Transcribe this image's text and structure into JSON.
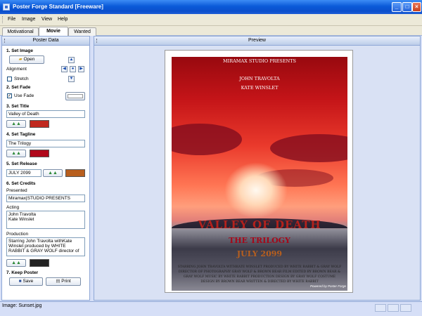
{
  "window": {
    "title": "Poster Forge Standard [Freeware]"
  },
  "menu": [
    "File",
    "Image",
    "View",
    "Help"
  ],
  "tabs": [
    "Motivational",
    "Movie",
    "Wanted"
  ],
  "left_pane": {
    "title": "Poster Data",
    "set_image": {
      "heading": "1. Set Image",
      "open_label": "Open",
      "alignment_label": "Alignment",
      "stretch_label": "Stretch",
      "stretch_checked": false
    },
    "set_fade": {
      "heading": "2. Set Fade",
      "use_fade_label": "Use Fade",
      "use_fade_checked": true,
      "fade_color": "#ffffff"
    },
    "set_title": {
      "heading": "3. Set Title",
      "value": "Valley of Death",
      "color": "#c0281e"
    },
    "set_tagline": {
      "heading": "4. Set Tagline",
      "value": "The Trilogy",
      "color": "#b0081a"
    },
    "set_release": {
      "heading": "5. Set Release",
      "value": "JULY 2099",
      "color": "#b85f1e"
    },
    "set_credits": {
      "heading": "6. Set Credits",
      "presented_label": "Presented",
      "presented_value": "Miramax|STUDIO PRESENTS",
      "acting_label": "Acting",
      "acting_value": "John Travolta\nKate Winslet",
      "production_label": "Production",
      "production_value": "Starring John Travolta withKate Winslet produced by WHITE RABBIT & GRAY WOLF director of",
      "color": "#222222"
    },
    "keep_poster": {
      "heading": "7. Keep Poster",
      "save_label": "Save",
      "print_label": "Print"
    }
  },
  "preview": {
    "title": "Preview",
    "poster": {
      "presented": "MIRAMAX STUDIO PRESENTS",
      "actor1": "JOHN TRAVOLTA",
      "actor2": "KATE WINSLET",
      "title": "VALLEY OF DEATH",
      "tagline": "THE TRILOGY",
      "release": "JULY 2099",
      "credits": "STARRING JOHN TRAVOLTA WITHKATE WINSLET PRODUCED BY WHITE RABBIT & GRAY WOLF DIRECTOR OF PHOTOGRAPHY GRAY WOLF & BROWN BEAR FILM EDITED BY BROWN BEAR & GRAY WOLF MUSIC BY WHITE RABBIT PRODUCTION DESIGN BY GRAY WOLF COSTUME DESIGN BY BROWN BEAR WRITTEN & DIRECTED BY WHITE RABBIT",
      "watermark": "Powered by Poster Forge"
    }
  },
  "status": {
    "text": "Image: Sunset.jpg"
  }
}
